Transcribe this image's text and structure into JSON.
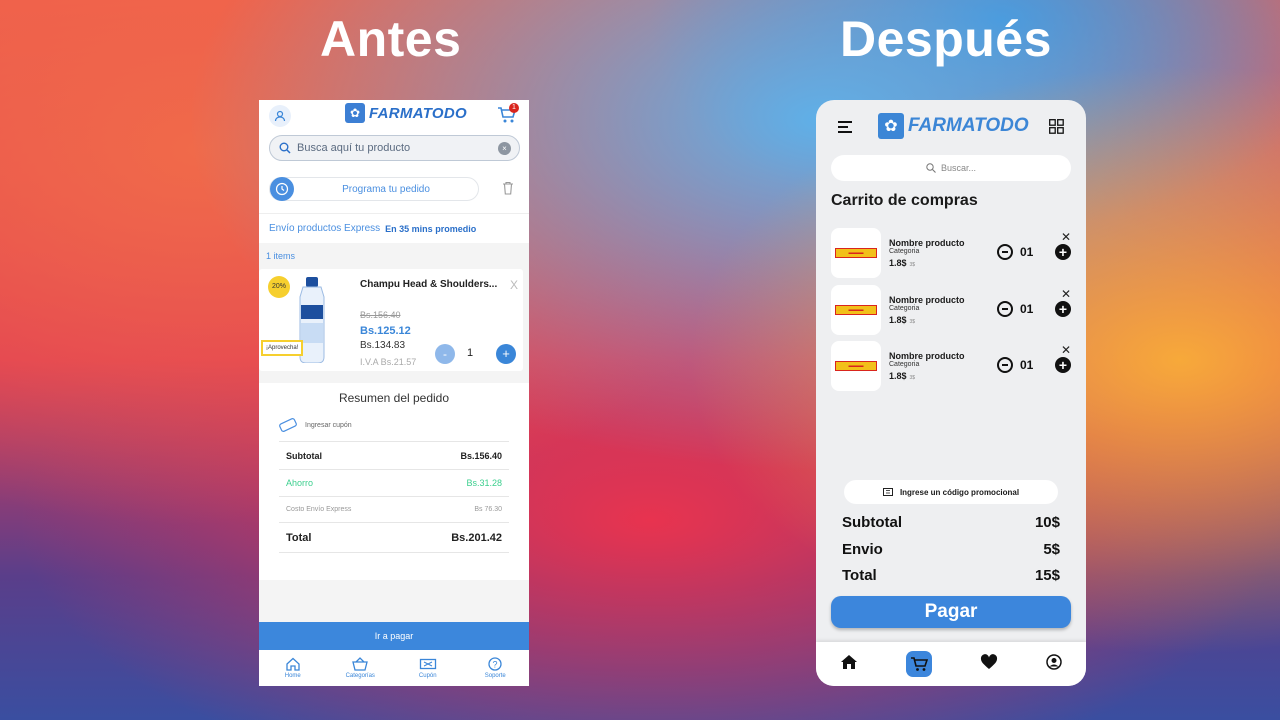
{
  "headings": {
    "before": "Antes",
    "after": "Después"
  },
  "antes": {
    "logo": "FARMATODO",
    "cart_count": "1",
    "search_placeholder": "Busca aquí tu producto",
    "schedule_label": "Programa tu pedido",
    "express_label": "Envío productos Express",
    "express_time": "En 35 mins promedio",
    "items_count": "1 items",
    "product": {
      "discount": "20%",
      "tag": "¡Aprovecha!",
      "name": "Champu Head & Shoulders...",
      "close": "X",
      "old_price": "Bs.156.40",
      "price": "Bs.125.12",
      "price_no_iva": "Bs.134.83",
      "iva": "I.V.A Bs.21.57",
      "minus": "-",
      "quantity": "1",
      "plus": "+"
    },
    "summary": {
      "title": "Resumen del pedido",
      "coupon": "Ingresar cupón",
      "subtotal_label": "Subtotal",
      "subtotal_value": "Bs.156.40",
      "savings_label": "Ahorro",
      "savings_value": "Bs.31.28",
      "shipping_label": "Costo Envío Express",
      "shipping_value": "Bs 76.30",
      "total_label": "Total",
      "total_value": "Bs.201.42"
    },
    "pay_button": "Ir a pagar",
    "nav": [
      "Home",
      "Categorías",
      "Cupón",
      "Soporte"
    ],
    "colors": {
      "accent": "#3c87dc",
      "savings": "#3ccf8e"
    }
  },
  "despues": {
    "logo": "FARMATODO",
    "search_placeholder": "Buscar...",
    "cart_title": "Carrito de compras",
    "items": [
      {
        "name": "Nombre producto",
        "category": "Categoria",
        "price": "1.8$",
        "price_note": "3$",
        "quantity": "01"
      },
      {
        "name": "Nombre producto",
        "category": "Categoria",
        "price": "1.8$",
        "price_note": "3$",
        "quantity": "01"
      },
      {
        "name": "Nombre producto",
        "category": "Categoria",
        "price": "1.8$",
        "price_note": "3$",
        "quantity": "01"
      }
    ],
    "close_glyph": "✕",
    "plus_glyph": "+",
    "promo_label": "Ingrese un código promocional",
    "subtotal_label": "Subtotal",
    "subtotal_value": "10$",
    "shipping_label": "Envio",
    "shipping_value": "5$",
    "total_label": "Total",
    "total_value": "15$",
    "pay_button": "Pagar",
    "nav_icons": [
      "home-icon",
      "cart-icon",
      "heart-icon",
      "profile-icon"
    ],
    "colors": {
      "accent": "#3c86dc"
    }
  }
}
